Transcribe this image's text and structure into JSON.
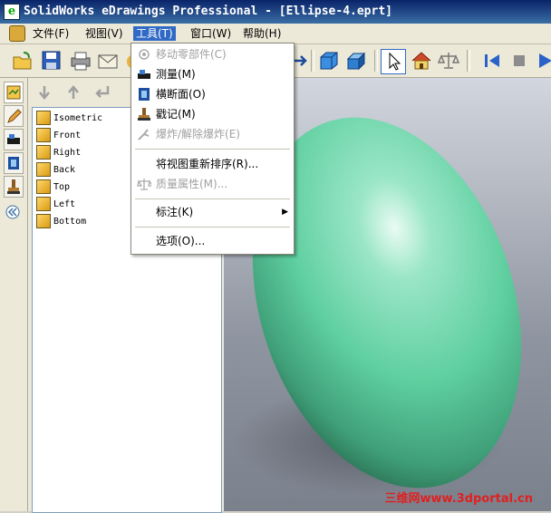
{
  "window": {
    "title": "SolidWorks eDrawings Professional - [Ellipse-4.eprt]",
    "icon": "e"
  },
  "menubar": {
    "items": [
      {
        "label": "文件(F)"
      },
      {
        "label": "视图(V)"
      },
      {
        "label": "工具(T)"
      },
      {
        "label": "窗口(W)"
      },
      {
        "label": "帮助(H)"
      }
    ]
  },
  "tools_menu": {
    "items": [
      {
        "label": "移动零部件(C)",
        "icon": "move-component-icon",
        "enabled": false
      },
      {
        "label": "测量(M)",
        "icon": "measure-icon",
        "enabled": true
      },
      {
        "label": "横断面(O)",
        "icon": "cross-section-icon",
        "enabled": true
      },
      {
        "label": "戳记(M)",
        "icon": "stamp-icon",
        "enabled": true
      },
      {
        "label": "爆炸/解除爆炸(E)",
        "icon": "explode-icon",
        "enabled": false
      },
      {
        "label": "将视图重新排序(R)...",
        "icon": "",
        "enabled": true
      },
      {
        "label": "质量属性(M)...",
        "icon": "mass-properties-icon",
        "enabled": false
      },
      {
        "label": "标注(K)",
        "icon": "",
        "enabled": true,
        "submenu": true
      },
      {
        "label": "选项(O)...",
        "icon": "",
        "enabled": true
      }
    ]
  },
  "views_panel": {
    "items": [
      {
        "label": "Isometric"
      },
      {
        "label": "Front"
      },
      {
        "label": "Right"
      },
      {
        "label": "Back"
      },
      {
        "label": "Top"
      },
      {
        "label": "Left"
      },
      {
        "label": "Bottom"
      }
    ]
  },
  "viewport": {
    "part_color": "#5fcfa0",
    "watermark": "三维网www.3dportal.cn"
  },
  "colors": {
    "title_bar": "#0a246a",
    "menu_highlight": "#316ac5"
  }
}
